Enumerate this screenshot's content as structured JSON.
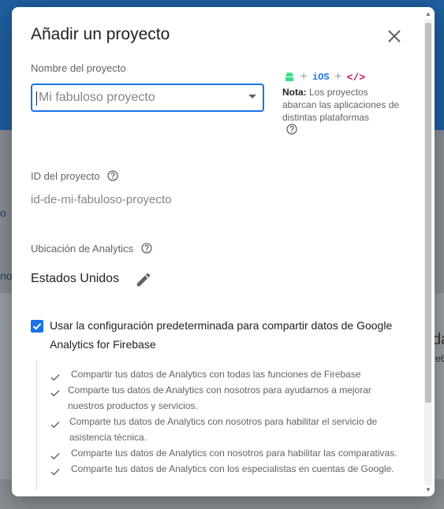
{
  "background": {
    "fragment_left_1": "o",
    "fragment_left_2": "no",
    "fragment_right_1": "da",
    "fragment_right_2": "re6"
  },
  "dialog": {
    "title": "Añadir un proyecto",
    "close_icon": "close-icon",
    "project_name": {
      "label": "Nombre del proyecto",
      "placeholder": "Mi fabuloso proyecto",
      "value": ""
    },
    "platforms": {
      "icons": [
        "android-icon",
        "ios-icon",
        "web-code-icon"
      ],
      "ios_text": "iOS",
      "plus": "+",
      "code_text": "</>"
    },
    "note": {
      "bold": "Nota:",
      "text": " Los proyectos abarcan las aplicaciones de distintas plataformas"
    },
    "project_id": {
      "label": "ID del proyecto",
      "value": "id-de-mi-fabuloso-proyecto"
    },
    "analytics_location": {
      "label": "Ubicación de Analytics",
      "value": "Estados Unidos"
    },
    "sharing": {
      "checked": true,
      "label": "Usar la configuración predeterminada para compartir datos de Google Analytics for Firebase",
      "items": [
        "Compartir tus datos de Analytics con todas las funciones de Firebase",
        "Comparte tus datos de Analytics con nosotros para ayudarnos a mejorar nuestros productos y servicios.",
        "Comparte tus datos de Analytics con nosotros para habilitar el servicio de asistencia técnica.",
        "Comparte tus datos de Analytics con nosotros para habilitar las comparativas.",
        "Comparte tus datos de Analytics con los especialistas en cuentas de Google."
      ]
    }
  },
  "colors": {
    "accent": "#1a73e8",
    "android": "#3ddc84",
    "code": "#c2185b"
  }
}
